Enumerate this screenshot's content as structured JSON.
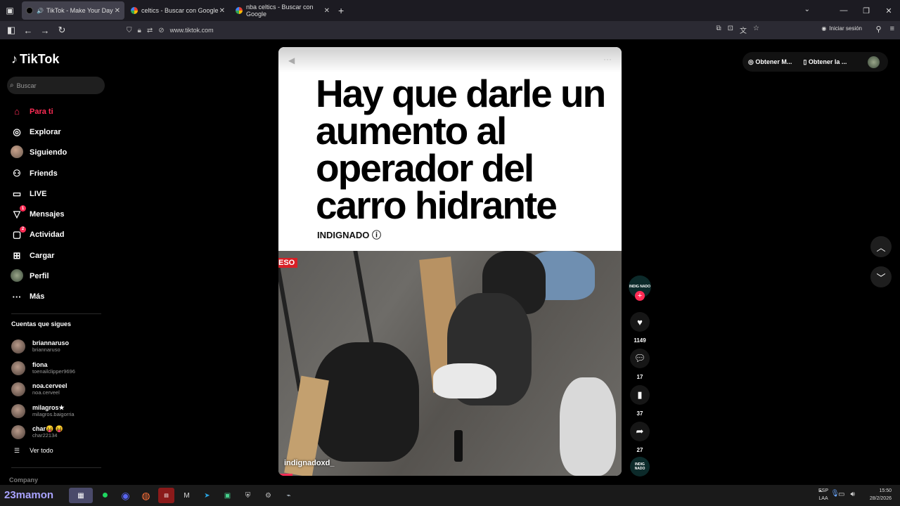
{
  "browser": {
    "tabs": [
      {
        "title": "TikTok - Make Your Day",
        "active": true
      },
      {
        "title": "celtics - Buscar con Google",
        "active": false
      },
      {
        "title": "nba celtics - Buscar con Google",
        "active": false
      }
    ],
    "url": "www.tiktok.com",
    "signin_label": "Iniciar sesión"
  },
  "sidebar": {
    "logo": "TikTok",
    "search_placeholder": "Buscar",
    "menu": [
      {
        "label": "Para ti",
        "icon": "home-icon",
        "active": true
      },
      {
        "label": "Explorar",
        "icon": "compass-icon"
      },
      {
        "label": "Siguiendo",
        "icon": "avatar-icon"
      },
      {
        "label": "Friends",
        "icon": "friends-icon"
      },
      {
        "label": "LIVE",
        "icon": "live-icon"
      },
      {
        "label": "Mensajes",
        "icon": "messages-icon",
        "badge": "1"
      },
      {
        "label": "Actividad",
        "icon": "activity-icon",
        "badge": "2"
      },
      {
        "label": "Cargar",
        "icon": "upload-icon"
      },
      {
        "label": "Perfil",
        "icon": "profile-avatar-icon"
      },
      {
        "label": "Más",
        "icon": "more-icon"
      }
    ],
    "following_title": "Cuentas que sigues",
    "accounts": [
      {
        "name": "briannaruso",
        "handle": "briannaruso"
      },
      {
        "name": "fiona",
        "handle": "toenailclipper9696"
      },
      {
        "name": "noa.cerveel",
        "handle": "noa.cerveel"
      },
      {
        "name": "milagros★",
        "handle": "milagros.baigorria"
      },
      {
        "name": "char😝 😝",
        "handle": "char22134"
      }
    ],
    "see_all": "Ver todo",
    "company": "Company"
  },
  "video": {
    "headline": "Hay que darle un aumento al operador del carro hidrante",
    "brand": "INDIGNADO ⓘ",
    "live_tag": "ESO",
    "uploader": "indignadoxd_",
    "creator_badge": "INDIG NADO",
    "likes": "1149",
    "comments": "17",
    "saves": "37",
    "shares": "27",
    "progress": 0.04
  },
  "topright": {
    "get_coins": "Obtener M...",
    "get_app": "Obtener la ..."
  },
  "taskbar": {
    "weather": "23mamon",
    "lang1": "ESP",
    "lang2": "LAA",
    "time": "15:50",
    "date": "28/2/2026"
  }
}
